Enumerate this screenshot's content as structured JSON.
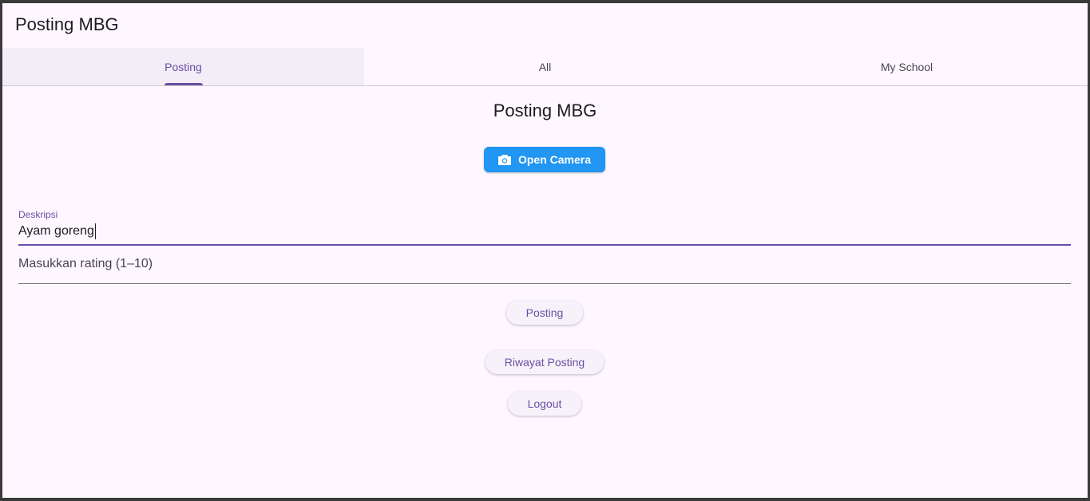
{
  "app": {
    "title": "Posting MBG"
  },
  "tabs": [
    {
      "label": "Posting",
      "active": true
    },
    {
      "label": "All",
      "active": false
    },
    {
      "label": "My School",
      "active": false
    }
  ],
  "main": {
    "heading": "Posting MBG",
    "camera_button": {
      "label": "Open Camera",
      "icon": "camera-icon"
    },
    "description_field": {
      "label": "Deskripsi",
      "value": "Ayam goreng"
    },
    "rating_field": {
      "placeholder": "Masukkan rating (1–10)",
      "value": ""
    },
    "posting_button": "Posting",
    "history_button": "Riwayat Posting",
    "logout_button": "Logout"
  },
  "colors": {
    "background": "#fef7ff",
    "accent": "#6750a4",
    "camera_button": "#2196f3"
  }
}
